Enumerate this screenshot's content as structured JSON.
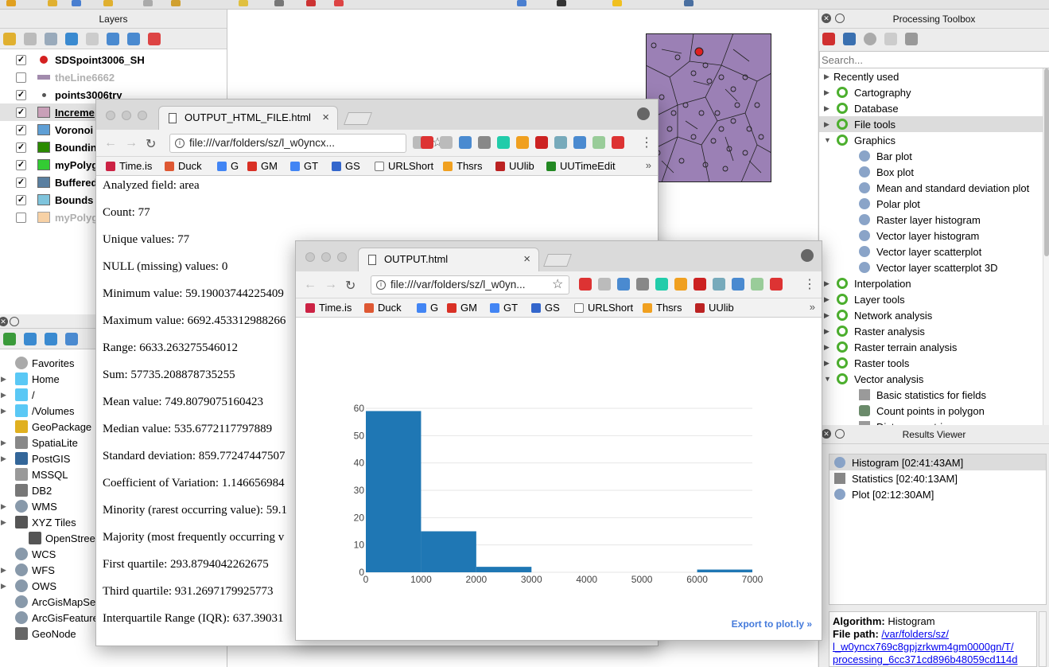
{
  "layers_panel": {
    "title": "Layers",
    "items": [
      {
        "name": "SDSpoint3006_SH",
        "checked": true,
        "bold": true,
        "grey": false,
        "color": "#d42020",
        "kind": "point"
      },
      {
        "name": "theLine6662",
        "checked": false,
        "bold": true,
        "grey": true,
        "color": "#7a5a8a",
        "kind": "line"
      },
      {
        "name": "points3006try",
        "checked": true,
        "bold": true,
        "grey": false,
        "color": "#555555",
        "kind": "smallpoint"
      },
      {
        "name": "Increme",
        "checked": true,
        "bold": true,
        "grey": false,
        "color": "#c9a0b8",
        "kind": "poly"
      },
      {
        "name": "Voronoi",
        "checked": true,
        "bold": true,
        "grey": false,
        "color": "#5f9fd5",
        "kind": "poly"
      },
      {
        "name": "Boundin",
        "checked": true,
        "bold": true,
        "grey": false,
        "color": "#2a8a00",
        "kind": "poly"
      },
      {
        "name": "myPolyg",
        "checked": true,
        "bold": true,
        "grey": false,
        "color": "#33cc33",
        "kind": "poly"
      },
      {
        "name": "Buffered",
        "checked": true,
        "bold": true,
        "grey": false,
        "color": "#5a7fa0",
        "kind": "poly"
      },
      {
        "name": "Bounds",
        "checked": true,
        "bold": true,
        "grey": false,
        "color": "#7fc4dc",
        "kind": "poly"
      },
      {
        "name": "myPolyg",
        "checked": false,
        "bold": true,
        "grey": true,
        "color": "#f3b36a",
        "kind": "poly"
      }
    ]
  },
  "browser_panel": {
    "items": [
      {
        "label": "Favorites",
        "icon": "star-icon",
        "color": "#aaaaaa",
        "expand": false,
        "indent": 0
      },
      {
        "label": "Home",
        "icon": "folder-icon",
        "color": "#5ac8f5",
        "expand": true,
        "indent": 0
      },
      {
        "label": "/",
        "icon": "folder-icon",
        "color": "#5ac8f5",
        "expand": true,
        "indent": 0
      },
      {
        "label": "/Volumes",
        "icon": "folder-icon",
        "color": "#5ac8f5",
        "expand": true,
        "indent": 0
      },
      {
        "label": "GeoPackage",
        "icon": "geopackage-icon",
        "color": "#e0b020",
        "expand": false,
        "indent": 0
      },
      {
        "label": "SpatiaLite",
        "icon": "spatialite-icon",
        "color": "#888888",
        "expand": true,
        "indent": 0
      },
      {
        "label": "PostGIS",
        "icon": "postgis-icon",
        "color": "#336699",
        "expand": true,
        "indent": 0
      },
      {
        "label": "MSSQL",
        "icon": "mssql-icon",
        "color": "#999999",
        "expand": false,
        "indent": 0
      },
      {
        "label": "DB2",
        "icon": "db2-icon",
        "color": "#777777",
        "expand": false,
        "indent": 0
      },
      {
        "label": "WMS",
        "icon": "globe-icon",
        "color": "#8899aa",
        "expand": true,
        "indent": 0
      },
      {
        "label": "XYZ Tiles",
        "icon": "tiles-icon",
        "color": "#555555",
        "expand": true,
        "indent": 0
      },
      {
        "label": "OpenStree",
        "icon": "tiles-icon",
        "color": "#555555",
        "expand": false,
        "indent": 1
      },
      {
        "label": "WCS",
        "icon": "globe-icon",
        "color": "#8899aa",
        "expand": false,
        "indent": 0
      },
      {
        "label": "WFS",
        "icon": "globe-icon",
        "color": "#8899aa",
        "expand": true,
        "indent": 0
      },
      {
        "label": "OWS",
        "icon": "globe-icon",
        "color": "#8899aa",
        "expand": true,
        "indent": 0
      },
      {
        "label": "ArcGisMapSe",
        "icon": "globe-icon",
        "color": "#8899aa",
        "expand": false,
        "indent": 0
      },
      {
        "label": "ArcGisFeature",
        "icon": "globe-icon",
        "color": "#8899aa",
        "expand": false,
        "indent": 0
      },
      {
        "label": "GeoNode",
        "icon": "geonode-icon",
        "color": "#666666",
        "expand": false,
        "indent": 0
      }
    ]
  },
  "toolbox": {
    "title": "Processing Toolbox",
    "search_placeholder": "Search...",
    "items": [
      {
        "label": "Recently used",
        "level": 0,
        "expand": "closed",
        "icon": "none",
        "selected": false
      },
      {
        "label": "Cartography",
        "level": 0,
        "expand": "closed",
        "icon": "q",
        "selected": false
      },
      {
        "label": "Database",
        "level": 0,
        "expand": "closed",
        "icon": "q",
        "selected": false
      },
      {
        "label": "File tools",
        "level": 0,
        "expand": "closed",
        "icon": "q",
        "selected": true
      },
      {
        "label": "Graphics",
        "level": 0,
        "expand": "open",
        "icon": "q",
        "selected": false
      },
      {
        "label": "Bar plot",
        "level": 1,
        "expand": "none",
        "icon": "gear",
        "selected": false
      },
      {
        "label": "Box plot",
        "level": 1,
        "expand": "none",
        "icon": "gear",
        "selected": false
      },
      {
        "label": "Mean and standard deviation plot",
        "level": 1,
        "expand": "none",
        "icon": "gear",
        "selected": false
      },
      {
        "label": "Polar plot",
        "level": 1,
        "expand": "none",
        "icon": "gear",
        "selected": false
      },
      {
        "label": "Raster layer histogram",
        "level": 1,
        "expand": "none",
        "icon": "gear",
        "selected": false
      },
      {
        "label": "Vector layer histogram",
        "level": 1,
        "expand": "none",
        "icon": "gear",
        "selected": false
      },
      {
        "label": "Vector layer scatterplot",
        "level": 1,
        "expand": "none",
        "icon": "gear",
        "selected": false
      },
      {
        "label": "Vector layer scatterplot 3D",
        "level": 1,
        "expand": "none",
        "icon": "gear",
        "selected": false
      },
      {
        "label": "Interpolation",
        "level": 0,
        "expand": "closed",
        "icon": "q",
        "selected": false
      },
      {
        "label": "Layer tools",
        "level": 0,
        "expand": "closed",
        "icon": "q",
        "selected": false
      },
      {
        "label": "Network analysis",
        "level": 0,
        "expand": "closed",
        "icon": "q",
        "selected": false
      },
      {
        "label": "Raster analysis",
        "level": 0,
        "expand": "closed",
        "icon": "q",
        "selected": false
      },
      {
        "label": "Raster terrain analysis",
        "level": 0,
        "expand": "closed",
        "icon": "q",
        "selected": false
      },
      {
        "label": "Raster tools",
        "level": 0,
        "expand": "closed",
        "icon": "q",
        "selected": false
      },
      {
        "label": "Vector analysis",
        "level": 0,
        "expand": "open",
        "icon": "q",
        "selected": false
      },
      {
        "label": "Basic statistics for fields",
        "level": 1,
        "expand": "none",
        "icon": "table",
        "selected": false
      },
      {
        "label": "Count points in polygon",
        "level": 1,
        "expand": "none",
        "icon": "points",
        "selected": false
      },
      {
        "label": "Distance matrix",
        "level": 1,
        "expand": "none",
        "icon": "table",
        "selected": false
      }
    ]
  },
  "results_viewer": {
    "title": "Results Viewer",
    "items": [
      {
        "label": "Histogram [02:41:43AM]",
        "icon": "gear",
        "selected": true
      },
      {
        "label": "Statistics [02:40:13AM]",
        "icon": "table",
        "selected": false
      },
      {
        "label": "Plot [02:12:30AM]",
        "icon": "gear",
        "selected": false
      }
    ],
    "algorithm_label": "Algorithm:",
    "algorithm_value": "Histogram",
    "filepath_label": "File path:",
    "filepath_lines": [
      "/var/folders/sz/",
      "l_w0yncx769c8gpjzrkwm4gm0000gn/T/",
      "processing_6cc371cd896b48059cd114d"
    ]
  },
  "bookmarks": [
    {
      "label": "Time.is",
      "color": "#cc2244"
    },
    {
      "label": "Duck",
      "color": "#de5833"
    },
    {
      "label": "G",
      "color": "#4285f4"
    },
    {
      "label": "GM",
      "color": "#d93025"
    },
    {
      "label": "GT",
      "color": "#4285f4"
    },
    {
      "label": "GS",
      "color": "#3366cc"
    },
    {
      "label": "URLShort",
      "color": "#ffffff"
    },
    {
      "label": "Thsrs",
      "color": "#f0a020"
    },
    {
      "label": "UUlib",
      "color": "#bb2222"
    },
    {
      "label": "UUTimeEdit",
      "color": "#228822"
    }
  ],
  "browser_back": {
    "tab_title": "OUTPUT_HTML_FILE.html",
    "url": "file:///var/folders/sz/l_w0yncx...",
    "stats": [
      "Analyzed field: area",
      "Count: 77",
      "Unique values: 77",
      "NULL (missing) values: 0",
      "Minimum value: 59.19003744225409",
      "Maximum value: 6692.453312988266",
      "Range: 6633.263275546012",
      "Sum: 57735.208878735255",
      "Mean value: 749.8079075160423",
      "Median value: 535.6772117797889",
      "Standard deviation: 859.77247447507",
      "Coefficient of Variation: 1.146656984",
      "Minority (rarest occurring value): 59.1",
      "Majority (most frequently occurring v",
      "First quartile: 293.8794042262675",
      "Third quartile: 931.2697179925773",
      "Interquartile Range (IQR): 637.39031"
    ]
  },
  "browser_front": {
    "tab_title": "OUTPUT.html",
    "url": "file:///var/folders/sz/l_w0yn...",
    "export_link": "Export to plot.ly »"
  },
  "chart_data": {
    "type": "bar",
    "bins": [
      [
        0,
        1000
      ],
      [
        1000,
        2000
      ],
      [
        2000,
        3000
      ],
      [
        3000,
        4000
      ],
      [
        4000,
        5000
      ],
      [
        5000,
        6000
      ],
      [
        6000,
        7000
      ]
    ],
    "values": [
      59,
      15,
      2,
      0,
      0,
      0,
      1
    ],
    "x_ticks": [
      "0",
      "1000",
      "2000",
      "3000",
      "4000",
      "5000",
      "6000",
      "7000"
    ],
    "y_ticks": [
      "0",
      "10",
      "20",
      "30",
      "40",
      "50",
      "60"
    ],
    "xlim": [
      0,
      7000
    ],
    "ylim": [
      0,
      60
    ],
    "bar_color": "#1f77b4",
    "grid": true
  }
}
